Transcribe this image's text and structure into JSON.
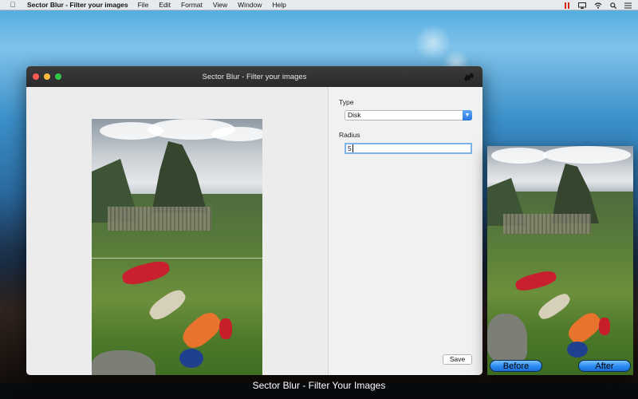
{
  "menubar": {
    "app_name": "Sector Blur - Filter your images",
    "items": [
      "File",
      "Edit",
      "Format",
      "View",
      "Window",
      "Help"
    ],
    "status_icons": [
      "pause-icon",
      "airplay-icon",
      "wifi-icon",
      "search-icon",
      "list-icon"
    ]
  },
  "window": {
    "title": "Sector Blur - Filter your images"
  },
  "controls": {
    "type_label": "Type",
    "type_value": "Disk",
    "radius_label": "Radius",
    "radius_value": "5",
    "save_label": "Save"
  },
  "preview": {
    "before_label": "Before",
    "after_label": "After"
  },
  "caption": "Sector Blur - Filter Your Images",
  "colors": {
    "accent": "#2a78e2",
    "close": "#fc5753",
    "minimize": "#fdbc40",
    "maximize": "#33c748",
    "pause_red": "#d9291c"
  }
}
